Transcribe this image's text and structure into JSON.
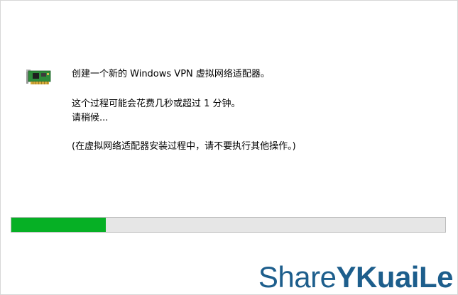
{
  "dialog": {
    "line_create": "创建一个新的 Windows VPN 虚拟网络适配器。",
    "line_duration": "这个过程可能会花费几秒或超过 1 分钟。",
    "line_wait": "请稍候...",
    "line_note": "(在虚拟网络适配器安装过程中，请不要执行其他操作。)"
  },
  "progress": {
    "value": 0.217,
    "fill_color": "#06b025",
    "track_color": "#e6e6e6"
  },
  "icons": {
    "adapter": "network-adapter-card-icon"
  },
  "watermark": {
    "part1": "Share",
    "part2": "YKuaiLe",
    "color": "#1d5e8c"
  }
}
